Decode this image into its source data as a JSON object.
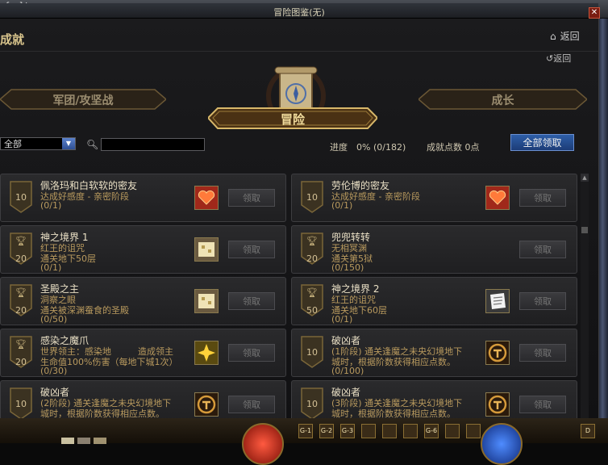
{
  "window": {
    "title": "冒险图鉴(无)",
    "left_tag": "efault"
  },
  "header": {
    "section": "成就",
    "back_label": "返回",
    "sub_back_label": "返回"
  },
  "tabs": {
    "left": "军团/攻坚战",
    "center": "冒险",
    "right": "成长"
  },
  "filter": {
    "selected": "全部",
    "search_placeholder": ""
  },
  "stats": {
    "progress": "进度　0%  (0/182)",
    "points": "成就点数 0点"
  },
  "claim_all_label": "全部领取",
  "claim_label": "领取",
  "cards": [
    {
      "badge": "10",
      "trophy": false,
      "title": "佩洛玛和白软软的密友",
      "l2": "达成好感度 - 亲密阶段",
      "l3": "(0/1)",
      "l4": "",
      "reward": "heart"
    },
    {
      "badge": "10",
      "trophy": false,
      "title": "劳伦博的密友",
      "l2": "达成好感度 - 亲密阶段",
      "l3": "(0/1)",
      "l4": "",
      "reward": "heart"
    },
    {
      "badge": "20",
      "trophy": true,
      "title": "神之境界 1",
      "l2": "红王的诅咒",
      "l3": "通关地下50层",
      "l4": "(0/1)",
      "reward": "map"
    },
    {
      "badge": "20",
      "trophy": true,
      "title": "兜兜转转",
      "l2": "无相冥渊",
      "l3": "通关第5狱",
      "l4": "(0/150)",
      "reward": "none"
    },
    {
      "badge": "20",
      "trophy": true,
      "title": "圣殿之主",
      "l2": "洞察之眼",
      "l3": "通关被深渊蚕食的圣殿",
      "l4": "(0/50)",
      "reward": "map"
    },
    {
      "badge": "50",
      "trophy": true,
      "title": "神之境界 2",
      "l2": "红王的诅咒",
      "l3": "通关地下60层",
      "l4": "(0/1)",
      "reward": "scroll"
    },
    {
      "badge": "20",
      "trophy": true,
      "title": "感染之魔爪",
      "l2": "世界领主：感染地　　　造成领主",
      "l3": "生命值100%伤害（每地下城1次）",
      "l4": "(0/30)",
      "reward": "star"
    },
    {
      "badge": "10",
      "trophy": false,
      "title": "破凶者",
      "l2": "(1阶段) 通关逢魔之未央幻境地下",
      "l3": "城时，根据阶数获得相应点数。",
      "l4": "(0/100)",
      "reward": "emblem"
    },
    {
      "badge": "10",
      "trophy": false,
      "title": "破凶者",
      "l2": "(2阶段) 通关逢魔之未央幻境地下",
      "l3": "城时，根据阶数获得相应点数。",
      "l4": "(0/200)",
      "reward": "emblem"
    },
    {
      "badge": "10",
      "trophy": false,
      "title": "破凶者",
      "l2": "(3阶段) 通关逢魔之未央幻境地下",
      "l3": "城时，根据阶数获得相应点数。",
      "l4": "(0/300)",
      "reward": "emblem"
    }
  ],
  "hud": {
    "slots": [
      "G-1",
      "G-2",
      "G-3",
      "",
      "",
      "",
      "G-6",
      "",
      "",
      "D"
    ]
  }
}
